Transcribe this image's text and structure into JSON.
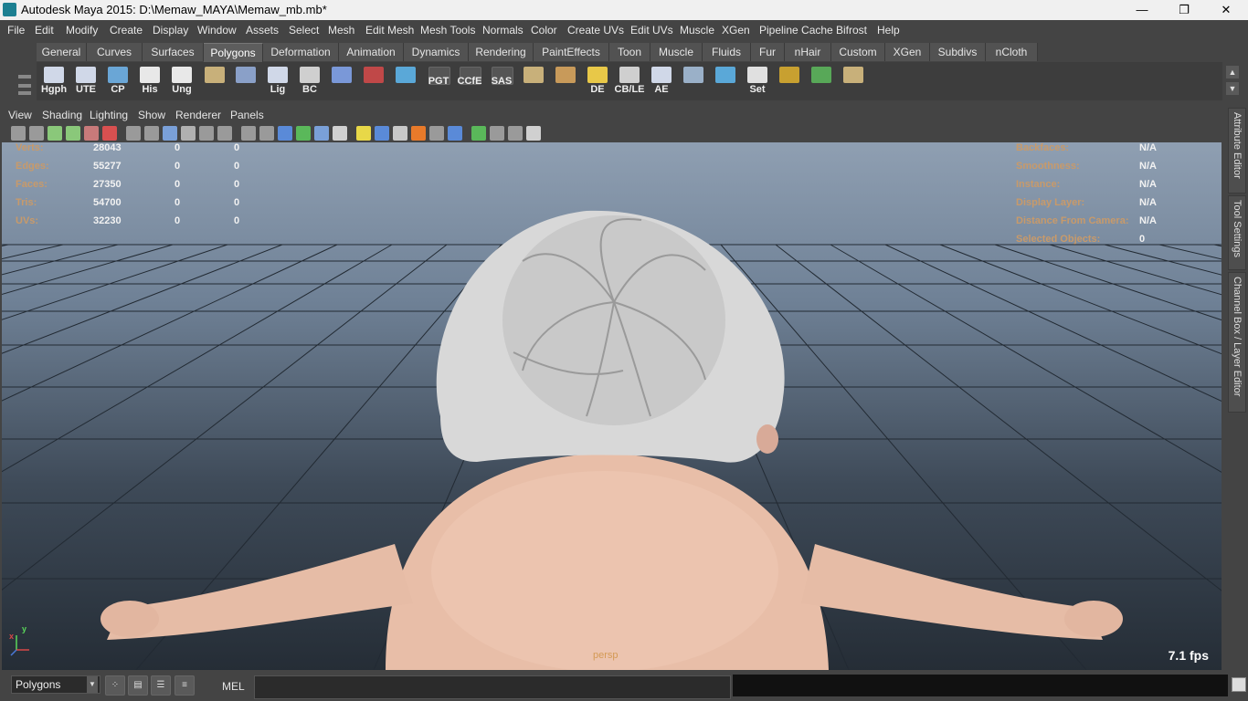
{
  "window": {
    "title": "Autodesk Maya 2015: D:\\Memaw_MAYA\\Memaw_mb.mb*",
    "minimize_label": "—",
    "maximize_label": "❐",
    "close_label": "✕"
  },
  "menubar": [
    "File",
    "Edit",
    "Modify",
    "Create",
    "Display",
    "Window",
    "Assets",
    "Select",
    "Mesh",
    "Edit Mesh",
    "Mesh Tools",
    "Normals",
    "Color",
    "Create UVs",
    "Edit UVs",
    "Muscle",
    "XGen",
    "Pipeline Cache",
    "Bifrost",
    "Help"
  ],
  "shelf_tabs": [
    "General",
    "Curves",
    "Surfaces",
    "Polygons",
    "Deformation",
    "Animation",
    "Dynamics",
    "Rendering",
    "PaintEffects",
    "Toon",
    "Muscle",
    "Fluids",
    "Fur",
    "nHair",
    "Custom",
    "XGen",
    "Subdivs",
    "nCloth"
  ],
  "active_shelf_tab": "Polygons",
  "shelf_items": [
    {
      "label": "Hgph",
      "icon": "hypergraph-icon",
      "color": "#d0d8e8"
    },
    {
      "label": "UTE",
      "icon": "uv-texture-editor-icon",
      "color": "#d0d8e8"
    },
    {
      "label": "CP",
      "icon": "component-pivot-icon",
      "color": "#6aa6d6"
    },
    {
      "label": "His",
      "icon": "history-icon",
      "color": "#e8e8e8"
    },
    {
      "label": "Ung",
      "icon": "ungroup-icon",
      "color": "#e8e8e8"
    },
    {
      "label": "",
      "icon": "rubber-stamp-icon",
      "color": "#c8b07a"
    },
    {
      "label": "",
      "icon": "globe-select-icon",
      "color": "#8aa0c8"
    },
    {
      "label": "Lig",
      "icon": "light-editor-icon",
      "color": "#d0d8e8"
    },
    {
      "label": "BC",
      "icon": "eye-icon",
      "color": "#cfcfcf"
    },
    {
      "label": "",
      "icon": "bounding-box-icon",
      "color": "#7a98d8"
    },
    {
      "label": "",
      "icon": "camera-bookmark-icon",
      "color": "#c04848"
    },
    {
      "label": "",
      "icon": "curve-tool-icon",
      "color": "#5aa8d8"
    },
    {
      "label": "PGT",
      "icon": "script-text-icon",
      "color": "#3d3d3d"
    },
    {
      "label": "CCfE",
      "icon": "script-text-icon",
      "color": "#3d3d3d"
    },
    {
      "label": "SAS",
      "icon": "script-text-icon",
      "color": "#3d3d3d"
    },
    {
      "label": "",
      "icon": "uv-layout-icon",
      "color": "#c8b07a"
    },
    {
      "label": "",
      "icon": "uv-grid-icon",
      "color": "#c89a5a"
    },
    {
      "label": "DE",
      "icon": "light-bulb-icon",
      "color": "#e8c848"
    },
    {
      "label": "CB/LE",
      "icon": "eye-icon",
      "color": "#cfcfcf"
    },
    {
      "label": "AE",
      "icon": "attribute-editor-icon",
      "color": "#d0d8e8"
    },
    {
      "label": "",
      "icon": "spotlight-icon",
      "color": "#9ab0c8"
    },
    {
      "label": "",
      "icon": "motion-path-icon",
      "color": "#5aa8d8"
    },
    {
      "label": "Set",
      "icon": "key-icon",
      "color": "#e0e0e0"
    },
    {
      "label": "",
      "icon": "target-icon",
      "color": "#c8a030"
    },
    {
      "label": "",
      "icon": "color-wheel-icon",
      "color": "#58a858"
    },
    {
      "label": "",
      "icon": "uv-layout-icon",
      "color": "#c8b07a"
    }
  ],
  "panel_menu": [
    "View",
    "Shading",
    "Lighting",
    "Show",
    "Renderer",
    "Panels"
  ],
  "panel_tools": [
    {
      "icon": "select-camera-icon",
      "color": "#9a9a9a"
    },
    {
      "icon": "camera-attributes-icon",
      "color": "#9a9a9a"
    },
    {
      "icon": "bookmark-icon",
      "color": "#8ac87a"
    },
    {
      "icon": "image-plane-icon",
      "color": "#8ac87a"
    },
    {
      "icon": "2d-pan-icon",
      "color": "#c87a7a"
    },
    {
      "icon": "grease-pencil-icon",
      "color": "#d85050"
    },
    {
      "icon": "grid-toggle-icon",
      "color": "#9a9a9a"
    },
    {
      "icon": "film-gate-icon",
      "color": "#9a9a9a"
    },
    {
      "icon": "resolution-gate-icon",
      "color": "#7aa0d8"
    },
    {
      "icon": "gate-mask-icon",
      "color": "#b0b0b0"
    },
    {
      "icon": "field-chart-icon",
      "color": "#9a9a9a"
    },
    {
      "icon": "safe-action-icon",
      "color": "#9a9a9a"
    },
    {
      "icon": "safe-title-icon",
      "color": "#9a9a9a"
    },
    {
      "icon": "wireframe-icon",
      "color": "#9a9a9a"
    },
    {
      "icon": "smooth-shade-icon",
      "color": "#5a8ad8"
    },
    {
      "icon": "wireframe-on-shaded-icon",
      "color": "#5ab85a"
    },
    {
      "icon": "default-material-icon",
      "color": "#7aa0d8"
    },
    {
      "icon": "textured-icon",
      "color": "#d0d0d0"
    },
    {
      "icon": "lighting-icon",
      "color": "#e8d848"
    },
    {
      "icon": "shadows-icon",
      "color": "#5a8ad8"
    },
    {
      "icon": "ambient-occlusion-icon",
      "color": "#c8c8c8"
    },
    {
      "icon": "motion-blur-icon",
      "color": "#e87a2a"
    },
    {
      "icon": "anti-aliasing-icon",
      "color": "#9a9a9a"
    },
    {
      "icon": "depth-of-field-icon",
      "color": "#5a8ad8"
    },
    {
      "icon": "isolate-select-icon",
      "color": "#5ab85a"
    },
    {
      "icon": "xray-icon",
      "color": "#9a9a9a"
    },
    {
      "icon": "xray-active-icon",
      "color": "#9a9a9a"
    },
    {
      "icon": "xray-joints-icon",
      "color": "#d0d0d0"
    }
  ],
  "hud_left": [
    {
      "label": "Verts:",
      "v1": "28043",
      "v2": "0",
      "v3": "0"
    },
    {
      "label": "Edges:",
      "v1": "55277",
      "v2": "0",
      "v3": "0"
    },
    {
      "label": "Faces:",
      "v1": "27350",
      "v2": "0",
      "v3": "0"
    },
    {
      "label": "Tris:",
      "v1": "54700",
      "v2": "0",
      "v3": "0"
    },
    {
      "label": "UVs:",
      "v1": "32230",
      "v2": "0",
      "v3": "0"
    }
  ],
  "hud_right": [
    {
      "label": "Backfaces:",
      "value": "N/A"
    },
    {
      "label": "Smoothness:",
      "value": "N/A"
    },
    {
      "label": "Instance:",
      "value": "N/A"
    },
    {
      "label": "Display Layer:",
      "value": "N/A"
    },
    {
      "label": "Distance From Camera:",
      "value": "N/A"
    },
    {
      "label": "Selected Objects:",
      "value": "0"
    }
  ],
  "viewport": {
    "camera": "persp",
    "fps": "7.1 fps",
    "axis_x": "x",
    "axis_y": "y"
  },
  "side_tabs": [
    "Attribute Editor",
    "Tool Settings",
    "Channel Box / Layer Editor"
  ],
  "cmdline": {
    "mode": "Polygons",
    "mel_label": "MEL",
    "input_value": ""
  }
}
